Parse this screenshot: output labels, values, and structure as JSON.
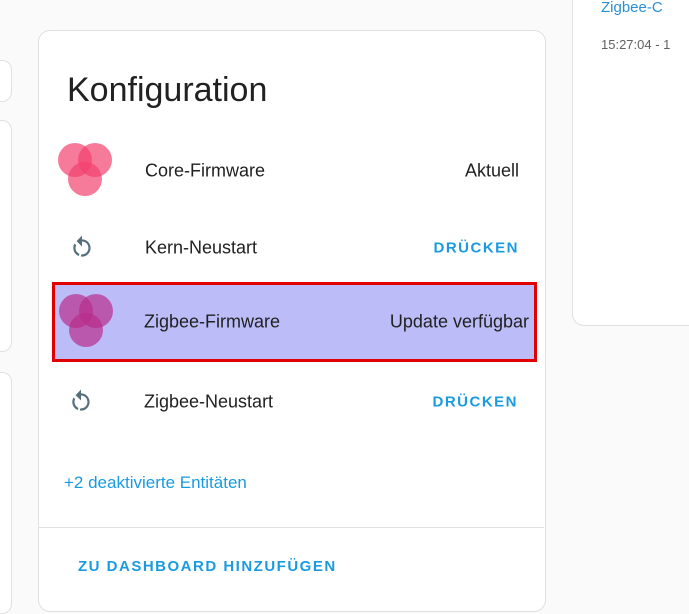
{
  "card": {
    "title": "Konfiguration",
    "rows": [
      {
        "label": "Core-Firmware",
        "value": "Aktuell",
        "icon": "firmware-update-icon",
        "icon_color": "#f2426f"
      },
      {
        "label": "Kern-Neustart",
        "action": "DRÜCKEN",
        "icon": "restart-icon"
      },
      {
        "label": "Zigbee-Firmware",
        "value": "Update verfügbar",
        "icon": "firmware-update-icon",
        "icon_color": "#b82d8c"
      },
      {
        "label": "Zigbee-Neustart",
        "action": "DRÜCKEN",
        "icon": "restart-icon"
      }
    ],
    "disabled_entities_link": "+2 deaktivierte Entitäten",
    "add_to_dashboard": "ZU DASHBOARD HINZUFÜGEN"
  },
  "right_card": {
    "title": "Zigbee-C",
    "time": "15:27:04 - 1"
  },
  "colors": {
    "accent": "#1a9be0",
    "highlight_fill": "#bcbcf9",
    "highlight_border": "#e00000"
  }
}
